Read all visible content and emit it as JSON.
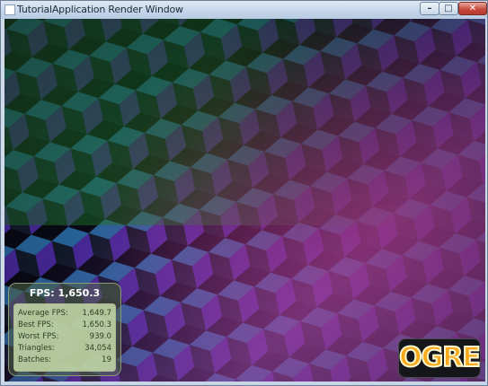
{
  "window": {
    "title": "TutorialApplication Render Window",
    "controls": {
      "minimize": "–",
      "maximize": "□",
      "close": "✕"
    }
  },
  "stats": {
    "fps_label": "FPS: 1,650.3",
    "rows": [
      {
        "label": "Average FPS:",
        "value": "1,649.7"
      },
      {
        "label": "Best FPS:",
        "value": "1,650.3"
      },
      {
        "label": "Worst FPS:",
        "value": "939.0"
      },
      {
        "label": "Triangles:",
        "value": "34,054"
      },
      {
        "label": "Batches:",
        "value": "19"
      }
    ]
  },
  "logo": {
    "text": "OGRE"
  }
}
